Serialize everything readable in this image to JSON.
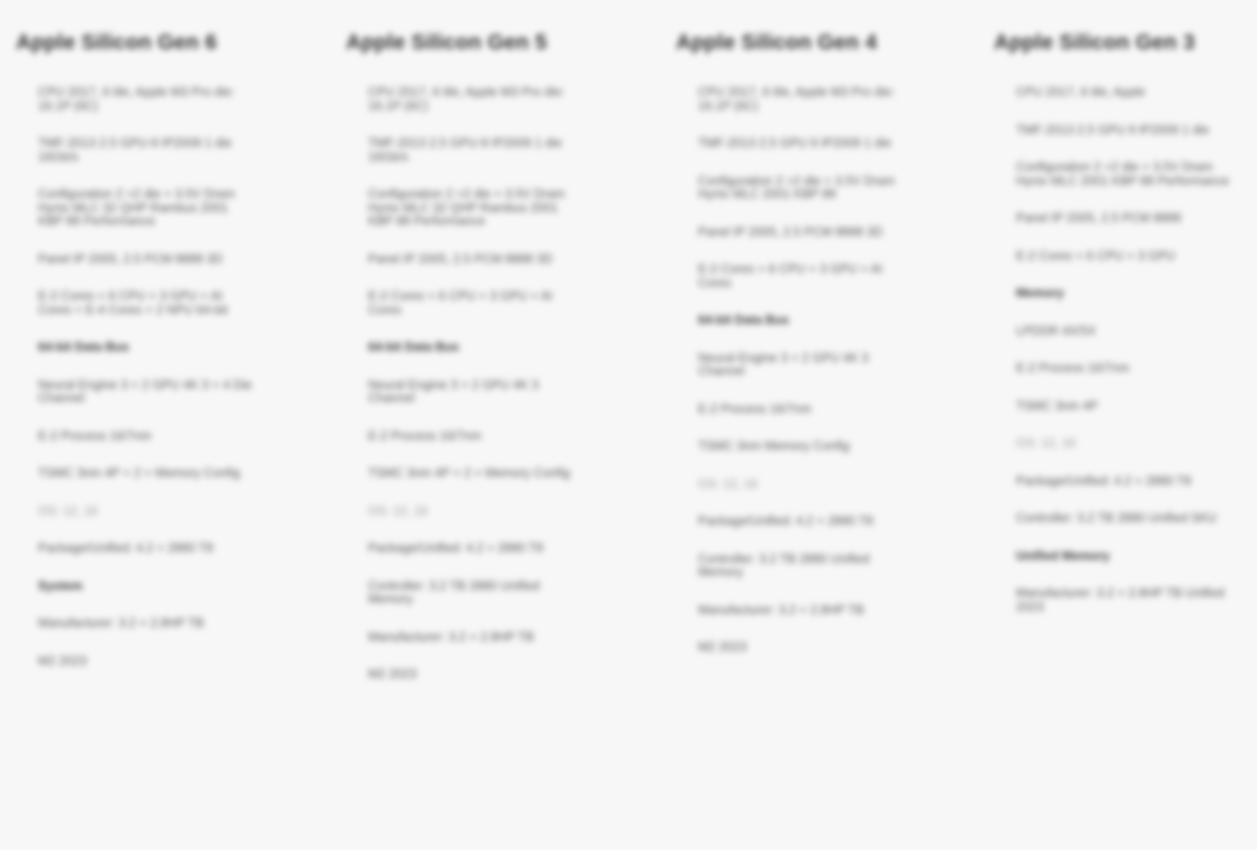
{
  "columns": [
    {
      "title": "Apple Silicon Gen 6",
      "items": [
        {
          "text": "CPU 2017, 6 tile, Apple M3 Pro die: 16.1P (6C)",
          "style": ""
        },
        {
          "text": "TMF-2013 2.5 GPU-9 IP2009 1 die 16Gb/s",
          "style": ""
        },
        {
          "text": "Configuration 2 +2 die + 3.5V Dram Hynix MLC 32 QHP Rambus 2001 KBP 88 Performance",
          "style": ""
        },
        {
          "text": "Panel IP 2005, 2.5 PCM 8888 3D",
          "style": ""
        },
        {
          "text": "E-2 Cores + 6 CPU + 3 GPU + AI Cores + E-4 Cores + 2 NPU 64-bit",
          "style": ""
        },
        {
          "text": "64-bit Data Bus",
          "style": "bold"
        },
        {
          "text": "Neural Engine 3 + 2 GPU 4K 3 + 4 Die Channel",
          "style": ""
        },
        {
          "text": "E-2 Process 16/7nm",
          "style": ""
        },
        {
          "text": "TSMC 3nm 4P + 2 + Memory Config",
          "style": ""
        },
        {
          "text": "OS: 12, 16",
          "style": "faint"
        },
        {
          "text": "Package/Unified: 4.2 + 2880 T8",
          "style": ""
        },
        {
          "text": "System",
          "style": "bold"
        },
        {
          "text": "Manufacturer: 3.2 + 2.8HP TB",
          "style": ""
        },
        {
          "text": "M2 2023",
          "style": ""
        }
      ]
    },
    {
      "title": "Apple Silicon Gen 5",
      "items": [
        {
          "text": "CPU 2017, 6 tile, Apple M3 Pro die: 16.1P (6C)",
          "style": ""
        },
        {
          "text": "TMF-2013 2.5 GPU-9 IP2009 1 die 16Gb/s",
          "style": ""
        },
        {
          "text": "Configuration 2 +2 die + 3.5V Dram Hynix MLC 32 QHP Rambus 2001 KBP 88 Performance",
          "style": ""
        },
        {
          "text": "Panel IP 2005, 2.5 PCM 8888 3D",
          "style": ""
        },
        {
          "text": "E-2 Cores + 6 CPU + 3 GPU + AI Cores",
          "style": ""
        },
        {
          "text": "64-bit Data Bus",
          "style": "bold"
        },
        {
          "text": "Neural Engine 3 + 2 GPU 4K 3 Channel",
          "style": ""
        },
        {
          "text": "E-2 Process 16/7nm",
          "style": ""
        },
        {
          "text": "TSMC 3nm 4P + 2 + Memory Config",
          "style": ""
        },
        {
          "text": "OS: 12, 16",
          "style": "faint"
        },
        {
          "text": "Package/Unified: 4.2 + 2880 T8",
          "style": ""
        },
        {
          "text": "Controller: 3.2 TB 2880 Unified Memory",
          "style": ""
        },
        {
          "text": "Manufacturer: 3.2 + 2.8HP TB",
          "style": ""
        },
        {
          "text": "M2 2023",
          "style": ""
        }
      ]
    },
    {
      "title": "Apple Silicon Gen 4",
      "items": [
        {
          "text": "CPU 2017, 6 tile, Apple M3 Pro die: 16.1P (6C)",
          "style": ""
        },
        {
          "text": "TMF-2013 2.5 GPU 9 IP2009 1 die",
          "style": ""
        },
        {
          "text": "Configuration 2 +2 die + 3.5V Dram Hynix MLC 2001 KBP 88",
          "style": ""
        },
        {
          "text": "Panel IP 2005, 2.5 PCM 8888 3D",
          "style": ""
        },
        {
          "text": "E-2 Cores + 6 CPU + 3 GPU + AI Cores",
          "style": ""
        },
        {
          "text": "64-bit Data Bus",
          "style": "bold"
        },
        {
          "text": "Neural Engine 3 + 2 GPU 4K 3 Channel",
          "style": ""
        },
        {
          "text": "E-2 Process 16/7nm",
          "style": ""
        },
        {
          "text": "TSMC 3nm Memory Config",
          "style": ""
        },
        {
          "text": "OS: 12, 16",
          "style": "faint"
        },
        {
          "text": "Package/Unified: 4.2 + 2880 T8",
          "style": ""
        },
        {
          "text": "Controller: 3.2 TB 2880 Unified Memory",
          "style": ""
        },
        {
          "text": "Manufacturer: 3.2 + 2.8HP TB",
          "style": ""
        },
        {
          "text": "M2 2023",
          "style": ""
        }
      ]
    },
    {
      "title": "Apple Silicon Gen 3",
      "items": [
        {
          "text": "CPU 2017, 6 tile, Apple",
          "style": ""
        },
        {
          "text": "TMF-2013 2.5 GPU 9 IP2009 1 die",
          "style": ""
        },
        {
          "text": "Configuration 2 +2 die + 3.5V Dram Hynix MLC 2001 KBP 88 Performance",
          "style": ""
        },
        {
          "text": "Panel IP 2005, 2.5 PCM 8888",
          "style": ""
        },
        {
          "text": "E-2 Cores + 6 CPU + 3 GPU",
          "style": ""
        },
        {
          "text": "Memory",
          "style": "bold"
        },
        {
          "text": "LPDDR 4X/5X",
          "style": ""
        },
        {
          "text": "E-2 Process 16/7nm",
          "style": ""
        },
        {
          "text": "TSMC 3nm 4P",
          "style": ""
        },
        {
          "text": "OS: 12, 16",
          "style": "faint"
        },
        {
          "text": "Package/Unified: 4.2 + 2880 T8",
          "style": ""
        },
        {
          "text": "Controller: 3.2 TB 2880 Unified SKU",
          "style": ""
        },
        {
          "text": "Unified Memory",
          "style": "bold"
        },
        {
          "text": "Manufacturer: 3.2 + 2.8HP TB Unified 2023",
          "style": ""
        }
      ]
    }
  ]
}
